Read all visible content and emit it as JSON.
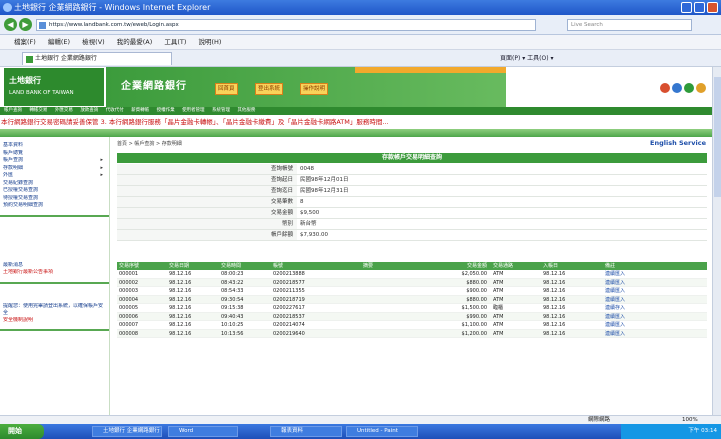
{
  "window": {
    "title": "土地銀行 企業網路銀行 - Windows Internet Explorer"
  },
  "address": {
    "url": "https://www.landbank.com.tw/eweb/Login.aspx",
    "search_placeholder": "Live Search"
  },
  "menu": [
    "檔案(F)",
    "編輯(E)",
    "檢視(V)",
    "我的最愛(A)",
    "工具(T)",
    "說明(H)"
  ],
  "tab": {
    "label": "土地銀行 企業網路銀行"
  },
  "toolbar": {
    "tools": "頁面(P) ▾ 工具(O) ▾"
  },
  "bank": {
    "name": "土地銀行",
    "name_sub": "LAND BANK OF TAIWAN",
    "banner_title": "企業網路銀行",
    "buttons": [
      "回首頁",
      "登出系統",
      "操作說明"
    ],
    "nav": [
      "帳戶查詢",
      "轉帳交易",
      "外匯交易",
      "放款查詢",
      "代收代付",
      "薪資轉帳",
      "授權作業",
      "使用者管理",
      "系統管理",
      "其他服務"
    ],
    "marquee": "本行網路銀行交易密碼請妥善保管 3. 本行網路銀行服務「晶片金融卡轉帳」、「晶片金融卡繳費」及「晶片金融卡網路ATM」服務時間..."
  },
  "sidebar": {
    "items": [
      {
        "label": "基本資料",
        "arrow": false
      },
      {
        "label": "帳戶總覽",
        "arrow": false
      },
      {
        "label": "帳戶查詢",
        "arrow": true
      },
      {
        "label": "存款明細",
        "arrow": true
      },
      {
        "label": "外匯",
        "arrow": true
      },
      {
        "label": "交易紀錄查詢",
        "arrow": false
      },
      {
        "label": "已授權交易查詢",
        "arrow": false
      },
      {
        "label": "待授權交易查詢",
        "arrow": false
      },
      {
        "label": "預約交易明細查詢",
        "arrow": false
      }
    ],
    "notice1": "最新消息",
    "notice1_link": "土地銀行最新公告事項",
    "notice2": "提醒您：使用完畢請登出系統，以確保帳戶安全",
    "notice2_link": "安全機制說明"
  },
  "content": {
    "breadcrumb": "首頁 > 帳戶查詢 > 存款明細",
    "english_link": "English Service",
    "form_title": "存款帳戶交易明細查詢",
    "fields": [
      {
        "label": "查詢帳號",
        "value": "0048"
      },
      {
        "label": "查詢起日",
        "value": "民國98年12月01日"
      },
      {
        "label": "查詢迄日",
        "value": "民國98年12月31日"
      },
      {
        "label": "交易筆數",
        "value": "8"
      },
      {
        "label": "交易金額",
        "value": "$9,500"
      },
      {
        "label": "幣別",
        "value": "新台幣"
      },
      {
        "label": "帳戶餘額",
        "value": "$7,930.00"
      }
    ],
    "columns": [
      "交易序號",
      "交易日期",
      "交易時間",
      "帳號",
      "摘要",
      "交易金額",
      "交易通路",
      "入帳日",
      "備註"
    ],
    "rows": [
      [
        "000001",
        "98.12.16",
        "08:00:23",
        "0200213888",
        "",
        "$2,050.00",
        "ATM",
        "98.12.16",
        "連續匯入"
      ],
      [
        "000002",
        "98.12.16",
        "08:43:22",
        "0200218577",
        "",
        "$880.00",
        "ATM",
        "98.12.16",
        "連續匯入"
      ],
      [
        "000003",
        "98.12.16",
        "08:54:33",
        "0200211355",
        "",
        "$900.00",
        "ATM",
        "98.12.16",
        "連續匯入"
      ],
      [
        "000004",
        "98.12.16",
        "09:30:54",
        "0200218719",
        "",
        "$880.00",
        "ATM",
        "98.12.16",
        "連續匯入"
      ],
      [
        "000005",
        "98.12.16",
        "09:15:38",
        "0200227617",
        "",
        "$1,500.00",
        "臨櫃",
        "98.12.16",
        "連續存入"
      ],
      [
        "000006",
        "98.12.16",
        "09:40:43",
        "0200218537",
        "",
        "$990.00",
        "ATM",
        "98.12.16",
        "連續匯入"
      ],
      [
        "000007",
        "98.12.16",
        "10:10:25",
        "0200214074",
        "",
        "$1,100.00",
        "ATM",
        "98.12.16",
        "連續匯入"
      ],
      [
        "000008",
        "98.12.16",
        "10:13:56",
        "0200219640",
        "",
        "$1,200.00",
        "ATM",
        "98.12.16",
        "連續匯入"
      ]
    ]
  },
  "status": {
    "zone": "網際網路",
    "zoom": "100%"
  },
  "taskbar": {
    "start": "開始",
    "buttons": [
      "土地銀行 企業網路銀行",
      "Word",
      "報表資料",
      "Untitled - Paint"
    ],
    "clock": "下午 03:14"
  }
}
